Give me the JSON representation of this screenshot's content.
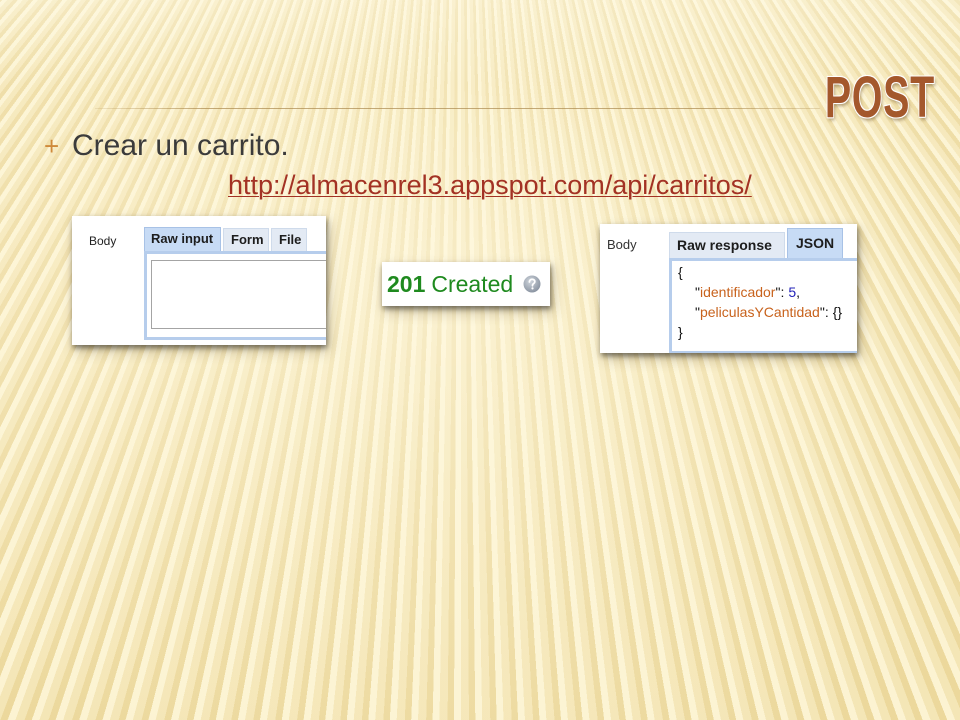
{
  "slide": {
    "title": "POST",
    "bullet": {
      "marker": "+",
      "text": "Crear un carrito."
    },
    "link": "http://almacenrel3.appspot.com/api/carritos/"
  },
  "request_panel": {
    "body_label": "Body",
    "tabs": [
      {
        "label": "Raw input",
        "selected": true
      },
      {
        "label": "Form",
        "selected": false
      },
      {
        "label": "File",
        "selected": false
      }
    ],
    "raw_input_value": ""
  },
  "status_panel": {
    "code": "201",
    "text": "Created",
    "icon": "help-icon"
  },
  "response_panel": {
    "body_label": "Body",
    "tabs": [
      {
        "label": "Raw response",
        "selected": false
      },
      {
        "label": "JSON",
        "selected": true
      }
    ],
    "json_view": {
      "open_brace": "{",
      "quote": "\"",
      "colon": ":",
      "entries": [
        {
          "key": "identificador",
          "value": "5",
          "separator": ","
        },
        {
          "key": "peliculasYCantidad",
          "value": "{}"
        }
      ],
      "close_brace": "}"
    }
  },
  "colors": {
    "title": "#a4582c",
    "bullet_marker": "#cf8a3b",
    "body_text": "#3b3b3b",
    "link": "#a33224",
    "status_green": "#1f8a1f",
    "tab_selected": "#c7dbf5",
    "tab_unselected": "#e3eaf4",
    "panel_border": "#b6cdec",
    "json_key": "#c8621c",
    "json_number": "#2323b8"
  }
}
